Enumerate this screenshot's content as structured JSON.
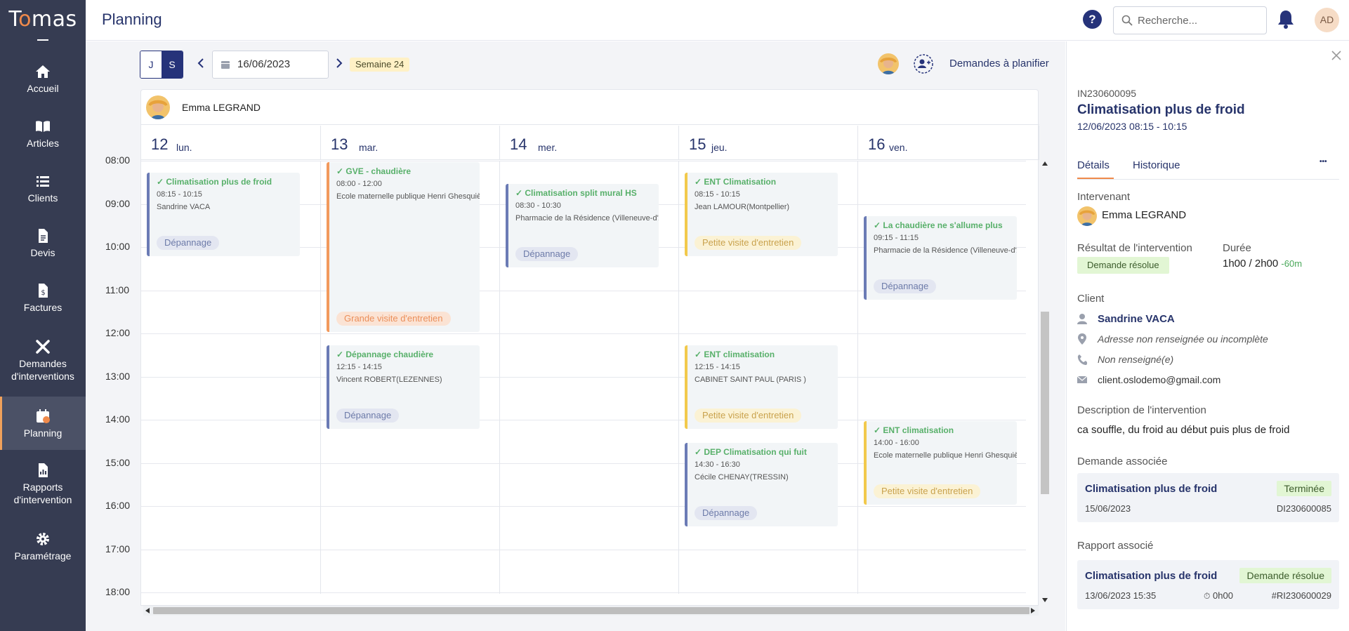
{
  "app": {
    "brand": "Tomas",
    "page_title": "Planning",
    "avatar_initials": "AD",
    "help_label": "?"
  },
  "search": {
    "placeholder": "Recherche..."
  },
  "nav": [
    {
      "label": "Accueil",
      "icon": "home-icon"
    },
    {
      "label": "Articles",
      "icon": "book-icon"
    },
    {
      "label": "Clients",
      "icon": "list-icon"
    },
    {
      "label": "Devis",
      "icon": "document-icon"
    },
    {
      "label": "Factures",
      "icon": "invoice-icon"
    },
    {
      "label": "Demandes d'interventions",
      "icon": "tools-icon"
    },
    {
      "label": "Planning",
      "icon": "calendar-icon",
      "active": true
    },
    {
      "label": "Rapports d'intervention",
      "icon": "report-icon"
    },
    {
      "label": "Paramétrage",
      "icon": "gear-icon"
    }
  ],
  "toolbar": {
    "view_day": "J",
    "view_week": "S",
    "date": "16/06/2023",
    "week": "Semaine 24",
    "demandes": "Demandes à planifier"
  },
  "calendar": {
    "technician": "Emma LEGRAND",
    "days": [
      {
        "num": "12",
        "name": "lun."
      },
      {
        "num": "13",
        "name": "mar."
      },
      {
        "num": "14",
        "name": "mer."
      },
      {
        "num": "15",
        "name": "jeu."
      },
      {
        "num": "16",
        "name": "ven."
      }
    ],
    "hours": [
      "08:00",
      "09:00",
      "10:00",
      "11:00",
      "12:00",
      "13:00",
      "14:00",
      "15:00",
      "16:00",
      "17:00",
      "18:00"
    ],
    "events": [
      {
        "day": 0,
        "start": 8.25,
        "end": 10.25,
        "title": "Climatisation plus de froid",
        "time": "08:15 - 10:15",
        "client": "Sandrine VACA",
        "tag": "Dépannage",
        "kind": "dep",
        "color": "blue"
      },
      {
        "day": 1,
        "start": 8.0,
        "end": 12.0,
        "title": "GVE - chaudière",
        "time": "08:00 - 12:00",
        "client": "Ecole maternelle publique Henri Ghesquiè",
        "tag": "Grande visite d'entretien",
        "kind": "gve",
        "color": "orange"
      },
      {
        "day": 1,
        "start": 12.25,
        "end": 14.25,
        "title": "Dépannage chaudière",
        "time": "12:15 - 14:15",
        "client": "Vincent ROBERT(LEZENNES)",
        "tag": "Dépannage",
        "kind": "dep",
        "color": "blue"
      },
      {
        "day": 2,
        "start": 8.5,
        "end": 10.5,
        "title": "Climatisation split mural HS",
        "time": "08:30 - 10:30",
        "client": "Pharmacie de la Résidence (Villeneuve-d'A",
        "tag": "Dépannage",
        "kind": "dep",
        "color": "blue"
      },
      {
        "day": 3,
        "start": 8.25,
        "end": 10.25,
        "title": "ENT Climatisation",
        "time": "08:15 - 10:15",
        "client": "Jean LAMOUR(Montpellier)",
        "tag": "Petite visite d'entretien",
        "kind": "pve",
        "color": "yellow"
      },
      {
        "day": 3,
        "start": 12.25,
        "end": 14.25,
        "title": "ENT climatisation",
        "time": "12:15 - 14:15",
        "client": "CABINET SAINT PAUL (PARIS )",
        "tag": "Petite visite d'entretien",
        "kind": "pve",
        "color": "yellow"
      },
      {
        "day": 3,
        "start": 14.5,
        "end": 16.5,
        "title": "DEP Climatisation qui fuit",
        "time": "14:30 - 16:30",
        "client": "Cécile CHENAY(TRESSIN)",
        "tag": "Dépannage",
        "kind": "dep",
        "color": "blue"
      },
      {
        "day": 4,
        "start": 9.25,
        "end": 11.25,
        "title": "La chaudière ne s'allume plus",
        "time": "09:15 - 11:15",
        "client": "Pharmacie de la Résidence (Villeneuve-d'A",
        "tag": "Dépannage",
        "kind": "dep",
        "color": "blue"
      },
      {
        "day": 4,
        "start": 14.0,
        "end": 16.0,
        "title": "ENT climatisation",
        "time": "14:00 - 16:00",
        "client": "Ecole maternelle publique Henri Ghesquiè",
        "tag": "Petite visite d'entretien",
        "kind": "pve",
        "color": "yellow"
      }
    ]
  },
  "panel": {
    "ref": "IN230600095",
    "title": "Climatisation plus de froid",
    "datetime": "12/06/2023 08:15 - 10:15",
    "tabs": [
      "Détails",
      "Historique"
    ],
    "more": "•••",
    "intervenant_label": "Intervenant",
    "intervenant": "Emma LEGRAND",
    "resultat_label": "Résultat de l'intervention",
    "resultat": "Demande résolue",
    "duree_label": "Durée",
    "duree": "1h00 / 2h00",
    "duree_diff": "-60m",
    "client_label": "Client",
    "client_name": "Sandrine VACA",
    "client_address": "Adresse non renseignée ou incomplète",
    "client_phone": "Non renseigné(e)",
    "client_email": "client.oslodemo@gmail.com",
    "desc_label": "Description de l'intervention",
    "desc": "ca souffle, du froid au début puis plus de froid",
    "demande_label": "Demande associée",
    "demande": {
      "title": "Climatisation plus de froid",
      "status": "Terminée",
      "date": "15/06/2023",
      "ref": "DI230600085"
    },
    "rapport_label": "Rapport associé",
    "rapport": {
      "title": "Climatisation plus de froid",
      "status": "Demande résolue",
      "date": "13/06/2023 15:35",
      "duration": "0h00",
      "ref": "#RI230600029"
    }
  },
  "colors": {
    "sidebar": "#363c52",
    "primary": "#26337a",
    "accent": "#f08a4b",
    "success_bg": "#e2f6d4"
  }
}
